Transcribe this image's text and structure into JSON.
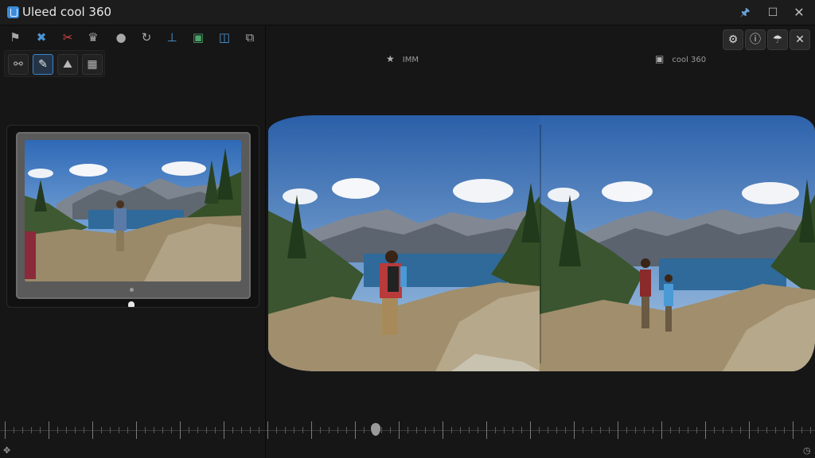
{
  "window": {
    "title": "Uleed cool 360",
    "controls": [
      "pin-icon",
      "maximize-icon",
      "close-icon"
    ]
  },
  "left_toolbar": {
    "row1": [
      {
        "icon": "flag-icon",
        "glyph": "⚑"
      },
      {
        "icon": "pin-tool-icon",
        "glyph": "✖",
        "color": "#4a95d6"
      },
      {
        "icon": "cut-icon",
        "glyph": "✂",
        "color": "#d24848"
      },
      {
        "icon": "brush-icon",
        "glyph": "♛"
      },
      {
        "icon": "pot-icon",
        "glyph": "●"
      },
      {
        "icon": "rotate-icon",
        "glyph": "↻"
      },
      {
        "icon": "stamp-icon",
        "glyph": "⊥",
        "color": "#4a95d6"
      },
      {
        "icon": "document-icon",
        "glyph": "▣",
        "color": "#4fa36a"
      },
      {
        "icon": "image-frame-icon",
        "glyph": "◫",
        "color": "#4a95d6"
      },
      {
        "icon": "layers-icon",
        "glyph": "⧉"
      }
    ],
    "row2": [
      {
        "icon": "link-icon",
        "glyph": "⚯"
      },
      {
        "icon": "draw-icon",
        "glyph": "✎",
        "active": true
      },
      {
        "icon": "landscape-icon",
        "glyph": "⛰"
      },
      {
        "icon": "photo-icon",
        "glyph": "▦"
      }
    ]
  },
  "right_toolbar": {
    "buttons": [
      {
        "icon": "gear-icon",
        "glyph": "⚙"
      },
      {
        "icon": "info-icon",
        "glyph": "ⓘ"
      },
      {
        "icon": "umbrella-icon",
        "glyph": "☂"
      },
      {
        "icon": "tools-icon",
        "glyph": "✕"
      }
    ]
  },
  "views": {
    "left_label": "IMM",
    "left_icon": "star-icon",
    "right_label": "cool 360",
    "right_icon": "camera-icon"
  },
  "timeline": {
    "left_icon": "move-icon",
    "right_icon": "clock-icon"
  },
  "colors": {
    "background": "#161616",
    "accent": "#3d84c9",
    "sky": "#4a83c9",
    "lake": "#2f6a9a"
  }
}
